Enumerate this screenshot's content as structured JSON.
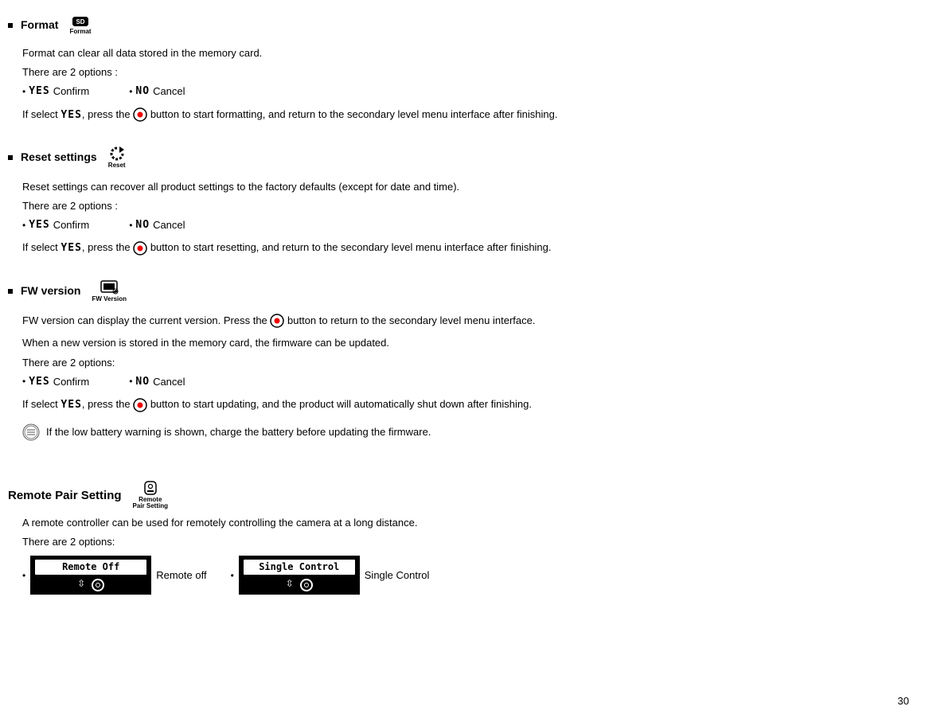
{
  "format": {
    "title": "Format",
    "iconLabel": "Format",
    "desc1": "Format can clear all data stored in the memory card.",
    "desc2": "There are 2 options :",
    "confirm": "Confirm",
    "cancel": "Cancel",
    "instr_pre": "If select ",
    "instr_mid": ", press the ",
    "instr_post": " button to start formatting, and return to the secondary level menu interface after finishing."
  },
  "reset": {
    "title": "Reset settings",
    "iconLabel": "Reset",
    "desc1": "Reset settings can recover all product settings to the factory defaults (except for date and time).",
    "desc2": "There are 2 options :",
    "confirm": "Confirm",
    "cancel": "Cancel",
    "instr_pre": "If select ",
    "instr_mid": ", press the ",
    "instr_post": " button to start resetting, and return to the secondary level menu interface after finishing."
  },
  "fw": {
    "title": "FW version",
    "iconLabel": "FW Version",
    "desc1_pre": "FW version can display the current version. Press the ",
    "desc1_post": " button to return to the secondary level menu interface.",
    "desc2": "When a new version is stored in the memory card, the firmware can be updated.",
    "desc3": "There are 2 options:",
    "confirm": "Confirm",
    "cancel": "Cancel",
    "instr_pre": "If select ",
    "instr_mid": ", press the ",
    "instr_post": " button to start updating, and the product will automatically shut down after finishing.",
    "note": "If the low battery warning is shown, charge the battery before updating the firmware."
  },
  "remote": {
    "title": "Remote Pair Setting",
    "iconLabel1": "Remote",
    "iconLabel2": "Pair Setting",
    "desc1": "A remote controller can be used for remotely controlling the camera at a long distance.",
    "desc2": "There are 2 options:",
    "off_box": "Remote Off",
    "off_label": "Remote off",
    "single_box": "Single Control",
    "single_label": "Single Control"
  },
  "glyphs": {
    "yes": "YES",
    "no": "NO"
  },
  "page": "30"
}
